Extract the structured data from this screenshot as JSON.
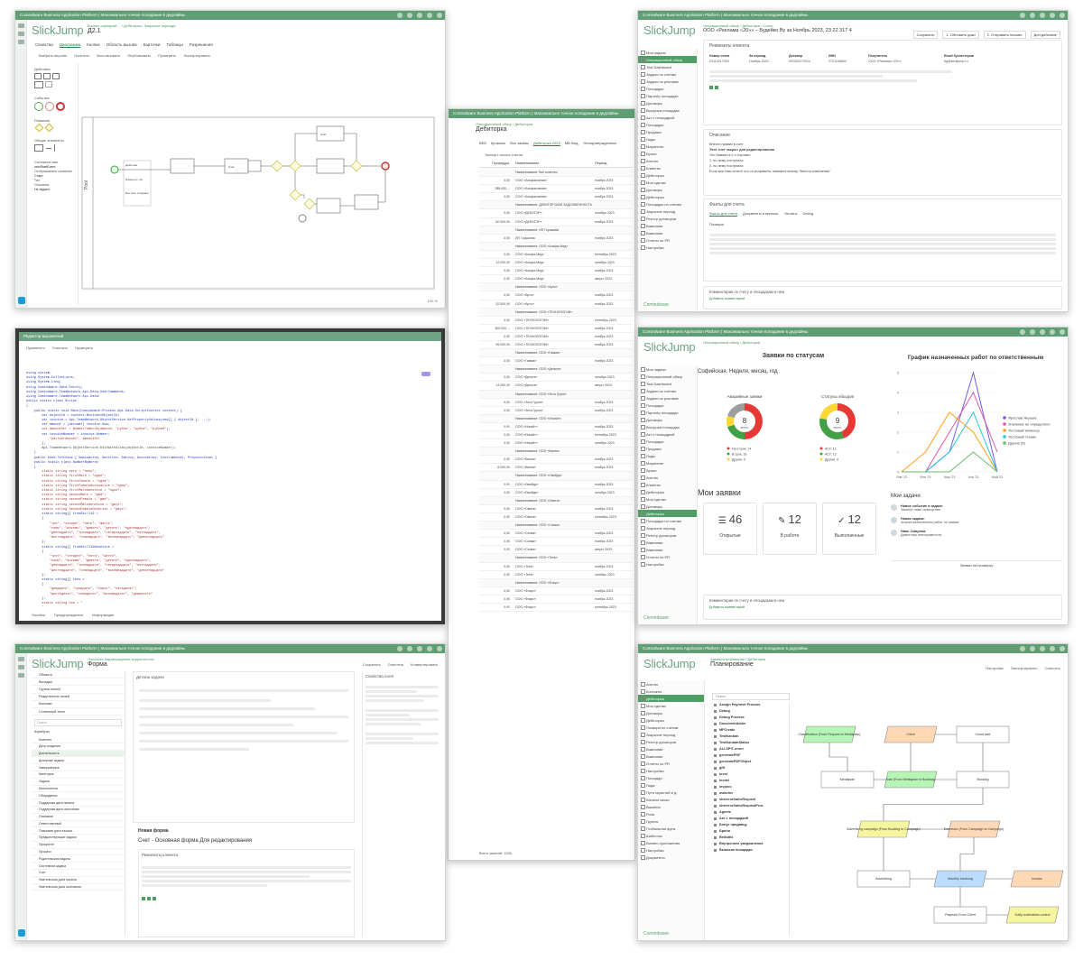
{
  "app_title": "Comindware Business Application Platform | Максимально точное попадание в дедлайны",
  "app_title_short": "Comindware Business Application Platform | Максимально точное попадание в дедлайны",
  "logo": "SlickJump",
  "footer_brand": "Comindware",
  "colors": {
    "accent": "#5e9e72",
    "nav_selected": "#4f9e66",
    "brand_blue": "#1a9bd7"
  },
  "win1": {
    "crumb": "Бизнес-сценарий ... / Дебиторка / Закрытие периода",
    "title": "Д2.1",
    "tabs": [
      "Свойства",
      "Диаграмма",
      "Кнопки",
      "Область вызова",
      "Карточки",
      "Таблицы",
      "Разрешения"
    ],
    "actions": [
      "Выбрать версию",
      "Очистить",
      "Восстановить",
      "Опубликовать",
      "Проверить",
      "Экспортировать"
    ],
    "palette_sections": [
      "Действия",
      "События",
      "Развилки",
      "Общие элементы"
    ],
    "palette_props": [
      "Системное имя",
      "Отображаемое название",
      "Тип",
      "Описание"
    ],
    "palette_prop_values": [
      "newStartEvent",
      "Старт",
      "Не задано"
    ],
    "pool_label": "Pool",
    "popup_title": "Изменить тип",
    "popup_sub": "Быстрое создание",
    "tasks": [
      "Действие",
      "Счет",
      "Счет"
    ],
    "footer_zoom": "100 %"
  },
  "win2": {
    "crumb": "Операционный обзор / Дебиторка",
    "title": "Дебиторка",
    "tabs": [
      "ВЕБ",
      "Кровные",
      "Все заказы",
      "Дебиторка 2023",
      "МВ бюд.",
      "Неподтвержденные"
    ],
    "toolbar": "Экспорт списка счетов",
    "columns": [
      "Процедура",
      "Наименование",
      "Период"
    ],
    "rows": [
      {
        "s": "",
        "n": "Наименование: Все клиенты",
        "p": ""
      },
      {
        "s": "0,00",
        "n": "ООО «Альфаклиник»",
        "p": "ноябрь 2023"
      },
      {
        "s": "288 000,...",
        "n": "ООО «Альфаклиник»",
        "p": "ноябрь 2023"
      },
      {
        "s": "0,00",
        "n": "ООО «Альфаклиник»",
        "p": "ноябрь 2023"
      },
      {
        "s": "",
        "n": "Наименование: ДЕБИТОРСКАЯ ЗАДОЛЖЕННОСТЬ",
        "p": ""
      },
      {
        "s": "0,00",
        "n": "ООО «ДЕБИТОР»",
        "p": "октябрь 2023"
      },
      {
        "s": "60 000,00",
        "n": "ООО «ДЕБИТОР»",
        "p": "ноябрь 2023"
      },
      {
        "s": "",
        "n": "Наименование: ИП Горшкова",
        "p": ""
      },
      {
        "s": "0,00",
        "n": "ИП Горшкова",
        "p": "ноябрь 2023"
      },
      {
        "s": "",
        "n": "Наименование: ООО «Альфа-Мед»",
        "p": ""
      },
      {
        "s": "0,00",
        "n": "ООО «Альфа-Мед»",
        "p": "сентябрь 2023"
      },
      {
        "s": "12 000,00",
        "n": "ООО «Альфа-Мед»",
        "p": "октябрь 2023"
      },
      {
        "s": "0,00",
        "n": "ООО «Альфа-Мед»",
        "p": "ноябрь 2023"
      },
      {
        "s": "0,00",
        "n": "ООО «Альфа-Мед»",
        "p": "август 2023"
      },
      {
        "s": "",
        "n": "Наименование: ООО «Арто»",
        "p": ""
      },
      {
        "s": "0,00",
        "n": "ООО «Арто»",
        "p": "ноябрь 2023"
      },
      {
        "s": "32 000,00",
        "n": "ООО «Арто»",
        "p": "ноябрь 2023"
      },
      {
        "s": "",
        "n": "Наименование: ООО «ТЕХНОЛОГИИ»",
        "p": ""
      },
      {
        "s": "0,00",
        "n": "ООО «ТЕХНОЛОГИИ»",
        "p": "сентябрь 2023"
      },
      {
        "s": "500 000,...",
        "n": "ООО «ТЕХНОЛОГИИ»",
        "p": "ноябрь 2023"
      },
      {
        "s": "0,00",
        "n": "ООО «ТЕХНОЛОГИИ»",
        "p": "ноябрь 2023"
      },
      {
        "s": "96 000,00",
        "n": "ООО «ТЕХНОЛОГИИ»",
        "p": "ноябрь 2023"
      },
      {
        "s": "",
        "n": "Наименование: ООО «Гамма»",
        "p": ""
      },
      {
        "s": "0,00",
        "n": "ООО «Гамма»",
        "p": "ноябрь 2023"
      },
      {
        "s": "",
        "n": "Наименование: ООО «Дельта»",
        "p": ""
      },
      {
        "s": "0,00",
        "n": "ООО «Дельта»",
        "p": "октябрь 2023"
      },
      {
        "s": "14 000,00",
        "n": "ООО «Дельта»",
        "p": "август 2023"
      },
      {
        "s": "",
        "n": "Наименование: ООО «Зета Групп»",
        "p": ""
      },
      {
        "s": "0,00",
        "n": "ООО «Зета Групп»",
        "p": "ноябрь 2023"
      },
      {
        "s": "0,00",
        "n": "ООО «Зета Групп»",
        "p": "ноябрь 2023"
      },
      {
        "s": "",
        "n": "Наименование: ООО «Инсайт»",
        "p": ""
      },
      {
        "s": "0,00",
        "n": "ООО «Инсайт»",
        "p": "ноябрь 2023"
      },
      {
        "s": "0,00",
        "n": "ООО «Инсайт»",
        "p": "сентябрь 2023"
      },
      {
        "s": "0,00",
        "n": "ООО «Инсайт»",
        "p": "октябрь 2023"
      },
      {
        "s": "",
        "n": "Наименование: ООО «Каппа»",
        "p": ""
      },
      {
        "s": "0,00",
        "n": "ООО «Каппа»",
        "p": "ноябрь 2023"
      },
      {
        "s": "8 000,00",
        "n": "ООО «Каппа»",
        "p": "ноябрь 2023"
      },
      {
        "s": "",
        "n": "Наименование: ООО «Лямбда»",
        "p": ""
      },
      {
        "s": "0,00",
        "n": "ООО «Лямбда»",
        "p": "ноябрь 2023"
      },
      {
        "s": "0,00",
        "n": "ООО «Лямбда»",
        "p": "октябрь 2023"
      },
      {
        "s": "",
        "n": "Наименование: ООО «Омега»",
        "p": ""
      },
      {
        "s": "0,00",
        "n": "ООО «Омега»",
        "p": "ноябрь 2023"
      },
      {
        "s": "0,00",
        "n": "ООО «Омега»",
        "p": "сентябрь 2023"
      },
      {
        "s": "",
        "n": "Наименование: ООО «Сигма»",
        "p": ""
      },
      {
        "s": "0,00",
        "n": "ООО «Сигма»",
        "p": "ноябрь 2023"
      },
      {
        "s": "0,00",
        "n": "ООО «Сигма»",
        "p": "ноябрь 2023"
      },
      {
        "s": "0,00",
        "n": "ООО «Сигма»",
        "p": "август 2023"
      },
      {
        "s": "",
        "n": "Наименование: ООО «Тета»",
        "p": ""
      },
      {
        "s": "0,00",
        "n": "ООО «Тета»",
        "p": "ноябрь 2023"
      },
      {
        "s": "0,00",
        "n": "ООО «Тета»",
        "p": "октябрь 2023"
      },
      {
        "s": "",
        "n": "Наименование: ООО «Фокус»",
        "p": ""
      },
      {
        "s": "0,00",
        "n": "ООО «Фокус»",
        "p": "ноябрь 2023"
      },
      {
        "s": "0,00",
        "n": "ООО «Фокус»",
        "p": "ноябрь 2023"
      },
      {
        "s": "0,00",
        "n": "ООО «Фокус»",
        "p": "сентябрь 2023"
      }
    ],
    "footer": "Всего записей: 1928"
  },
  "win3": {
    "crumb": "Операционный обзор / Дебиторка / Счета",
    "title": "ООО «Реклама «20»» – Будейко Ву за Ноябрь 2023, 23 22 317 4",
    "top_actions": [
      "Сохранить",
      "1. Обновить доки",
      "2. Отправить письмо",
      "Доп.действие"
    ],
    "nav_items": [
      "Мои задачи",
      "Операционный обзор",
      "Test Dashboard",
      "Задачи по счетам",
      "Задачи по рекламе",
      "Площадки",
      "Партнёр площадки",
      "Договоры",
      "Выгрузка площадок",
      "Акт с площадкой",
      "Площадки",
      "Продажи",
      "Лиды",
      "Маркетинг",
      "Брони",
      "Агенты",
      "Клиенты",
      "Дебиторка",
      "Мои сделки",
      "Договоры",
      "Дебиторка",
      "Площадки по счетам",
      "Закрытие период",
      "Реестр договоров",
      "Кампании",
      "Кампании",
      "Отчеты по PR",
      "Настройки"
    ],
    "section_client": "Реквизиты клиента",
    "client_labels": [
      "Номер счета",
      "За период",
      "Договор",
      "ИНН",
      "Получатель",
      "Email бухгалтерии"
    ],
    "client_values": [
      "23112017904",
      "Ноябрь 2023",
      "202303172914",
      "2721108604",
      "ООО «Реклама «20»»",
      "bg@slickjump.ru"
    ],
    "section_notes": "Описание",
    "notes": [
      "Внести правки в счет",
      "Этот счет закрыт для редактирования",
      "Это бывает в 2-х случаях:",
      "1. по нему поступила",
      "2. по нему поступила",
      "Если вся таки хотите что-то исправить, нажмите кнопку \"Внести изменения\""
    ],
    "section_invoice": "Факты для счета",
    "invoice_tabs": [
      "Факты для счета",
      "Документы и прилож.",
      "Оплаты",
      "Debug"
    ],
    "invoice_table": "Позиции",
    "comments_title": "Комментарии по счету и площадкам в нем",
    "comment_add": "Добавить комментарий"
  },
  "win4": {
    "crumb": "Нельзя подтвердить в редакторе",
    "title": "Редактор выражений",
    "actions": [
      "Применить",
      "Очистить",
      "Проверить"
    ],
    "status_tabs": [
      "Ошибки",
      "Предупреждения",
      "Информация"
    ],
    "code": [
      "using System;",
      "using System.Collections;",
      "using System.Linq;",
      "using Comindware.Data.Entity;",
      "using Comindware.TeamNetwork.Api.Data.UserCommands;",
      "using Comindware.TeamNetwork.Api.Data;",
      "public static class Script",
      "{",
      "    public static void Main(Comindware.Process.Api.Data.ScriptContext context) {",
      "",
      "        var objectId = context.BusinessObjectId;",
      "        var invoice = Api.TeamNetwork.ObjectService.GetPropertyValues(new[] { objectId }, ...);",
      "",
      "        var amount = (decimal) invoice.Sum;",
      "        var amountStr = NumberToWords(amount, \"рубль\", \"рубля\", \"рублей\");",
      "        var invoiceNumber = invoice.Number;",
      "            \"partnerAmount\", amountStr",
      "        };",
      "        Api.TeamNetwork.ObjectService.EditWithAlias(objectId, invoiceNumber);",
      "    }",
      "",
      "    public enum TextCase { Nominative, Genitive, Dative, Accusative, Instrumental, Prepositional }",
      "",
      "    public static class NumberByWords",
      "    {",
      "        static string zero = \"ноль\";",
      "        static string firstMale = \"один\";",
      "        static string firstFemale = \"одна\";",
      "        static string firstFemaleAccusative = \"одну\";",
      "        static string firstMaleGenetive = \"одно\";",
      "        static string secondMale = \"два\";",
      "        static string secondFemale = \"две\";",
      "        static string secondMaleGenetive = \"двух\";",
      "        static string secondFemaleGenetive = \"двух\";",
      "",
      "        static string[] from3till19 =",
      "        {",
      "            \"три\", \"четыре\", \"пять\", \"шесть\",",
      "            \"семь\", \"восемь\", \"девять\", \"десять\", \"одиннадцать\",",
      "            \"двенадцать\", \"тринадцать\", \"четырнадцать\", \"пятнадцать\",",
      "            \"шестнадцать\", \"семнадцать\", \"восемнадцать\", \"девятнадцать\"",
      "        };",
      "        static string[] from3till19Genetive =",
      "        {",
      "            \"трех\", \"четырех\", \"пяти\", \"шести\",",
      "            \"семи\", \"восеми\", \"девяти\", \"десяти\", \"одиннадцати\",",
      "            \"двенадцати\", \"тринадцати\", \"четырнадцати\", \"пятнадцати\",",
      "            \"шестнадцати\", \"семнадцати\", \"восемнадцати\", \"девятнадцати\"",
      "        };",
      "        static string[] tens =",
      "        {",
      "            \"двадцать\", \"тридцать\", \"сорок\", \"пятьдесят\",",
      "            \"шестьдесят\", \"семьдесят\", \"восемьдесят\", \"девяносто\"",
      "        };",
      "        static string hnd = \"",
      "        {",
      "            \"сто\", \"двести\", \"триста\", \"четыреста\",",
      "            \"пятьсот\", \"шестьсот\", \"семьсот\", \"восемьсот\", \"девятьсот\"",
      "        };"
    ]
  },
  "win5": {
    "crumb": "Операционный обзор / Дебиторка",
    "title": "Заявки по статусам",
    "chart_title": "График назначенных работ по ответственным",
    "donut_card": "Софийская. Неделя, месяц, год",
    "donut1_label": "Аварийные заявки",
    "donut1_value": "8",
    "donut1_caption": "всего",
    "donut2_label": "Статусы обходов",
    "donut2_value": "9",
    "donut2_caption": "всего",
    "donut1_legend": [
      "На в срок: 14",
      "В срок: 18",
      "Другие: 0"
    ],
    "donut2_legend": [
      "АСУ: 11",
      "АСУ: 12",
      "Другие: 6"
    ],
    "my_requests": "Мои заявки",
    "tiles": [
      {
        "n": "46",
        "l": "Открытые",
        "icon": "list-icon"
      },
      {
        "n": "12",
        "l": "В работе",
        "icon": "wrench-icon"
      },
      {
        "n": "12",
        "l": "Выполненные",
        "icon": "check-icon"
      }
    ],
    "my_tasks": "Мои задачи",
    "tasks": [
      {
        "t": "Новое событие в задаче:",
        "d": "Замена ламп освещения"
      },
      {
        "t": "Новая задача:",
        "d": "Анализ выполнения работ по заявке"
      },
      {
        "t": "Иван Смирнов",
        "d": "Демонтаж неисправности"
      }
    ],
    "task_button": "Заявки на проверку",
    "legend": [
      "Ярослав Якушев",
      "Значение не определено",
      "Тестовый инженер",
      "Тестовый техник",
      "Другие (5)"
    ],
    "legend_colors": [
      "#6c5ce7",
      "#e056a0",
      "#ff9f1a",
      "#26c6da",
      "#66bb6a"
    ],
    "x_labels": [
      "Янв '23",
      "Фев '23",
      "Мар '23",
      "Апр '23",
      "Май '23"
    ],
    "y_labels": [
      "0",
      "1",
      "2",
      "3",
      "4",
      "5"
    ],
    "comments_title": "Комментарии по счету и площадкам в нем",
    "comment_add": "Добавить комментарий"
  },
  "win6": {
    "crumb": "Получить подтверждение корректности",
    "title": "Форма",
    "top_actions": [
      "Сохранить",
      "Очистить",
      "Конвертировать"
    ],
    "left_items": [
      "Область",
      "Вкладка",
      "Группа полей",
      "Разделитель полей",
      "Колонки",
      "Статичный текст"
    ],
    "search": "Поиск",
    "attrs_title": "Атрибуты",
    "attrs": [
      "Клиенты",
      "Дата создания",
      "Длительность",
      "Дочерние задачи",
      "Завершенные",
      "Категория",
      "Задача",
      "Исполнитель",
      "Обсуждения",
      "Поддержка дата начала",
      "Поддержка дата окончания",
      "Описание",
      "Ответственный",
      "Плановая дата начала",
      "Предшествующие задачи",
      "Приоритет",
      "Процесс",
      "Родительская задача",
      "Системная задача",
      "Счет",
      "Фактическая дата начала",
      "Фактическая дата окончания"
    ],
    "form_title": "Детали задачи",
    "props_title": "Свойства поля",
    "form2_title": "Счет - Основная форма Для редактирования",
    "new_form": "Новая форма",
    "client_section": "Реквизиты клиента"
  },
  "win7": {
    "crumb": "Администрирование / Дебиторка",
    "title": "Планирование",
    "top_actions": [
      "Настройки",
      "Экспортировать",
      "Очистить"
    ],
    "search": "Поиск",
    "nav_items": [
      "Агенты",
      "Контакты",
      "Дебиторка",
      "Мои сделки",
      "Договоры",
      "Дебиторка",
      "Позиции по счетам",
      "Закрытие период",
      "Реестр договоров",
      "Кампании",
      "Кампании",
      "Отчеты по PR",
      "Настройки",
      "Площади",
      "Лида",
      "Пути гарантий в д.",
      "Каналы связи",
      "Вакансы",
      "Роли",
      "Группы",
      "Глобальная функ.",
      "Шаблоны",
      "Бизнес-приложения",
      "Настройки",
      "Документы"
    ],
    "list_items": [
      "Assign Payment Process",
      "Debug",
      "Debug Process",
      "DocumentAdder",
      "MFCreate",
      "TestKanban",
      "TestKanbanStatus",
      "ALLSPIT-отчет",
      "generatePDF",
      "generatePDFObject",
      "gift",
      "invst",
      "invdel",
      "invproc",
      "makeInv",
      "shserrorSalesRequest",
      "shserrorSalesRequestProc",
      "Agents",
      "Акт с площадкой",
      "Бонус продавцу",
      "Брони",
      "Bellcalls",
      "Внутреннее уведомление",
      "Выписка площадки"
    ],
    "nodes": [
      {
        "id": "n1",
        "t": "Classification (From Request to Mediaplan)",
        "c": "#b6f5b6"
      },
      {
        "id": "n2",
        "t": "Client",
        "c": "#ffd8b6"
      },
      {
        "id": "n3",
        "t": "Cross sale",
        "c": "#ffffff"
      },
      {
        "id": "n4",
        "t": "Mediaplan",
        "c": "#ffffff"
      },
      {
        "id": "n5",
        "t": "Sale (From Mediaplan to Booking)",
        "c": "#b6f5b6"
      },
      {
        "id": "n6",
        "t": "Booking",
        "c": "#ffffff"
      },
      {
        "id": "n7",
        "t": "Advertising campaign (From Booking to Campaign)",
        "c": "#f5f5a0"
      },
      {
        "id": "n8",
        "t": "Extension (From Campaign to Campaign)",
        "c": "#ffd8b6"
      },
      {
        "id": "n9",
        "t": "Advertising",
        "c": "#ffffff"
      },
      {
        "id": "n10",
        "t": "Monthly invoicing",
        "c": "#bcdcff"
      },
      {
        "id": "n11",
        "t": "Invoice",
        "c": "#ffd8b6"
      },
      {
        "id": "n12",
        "t": "Payment From Client",
        "c": "#ffffff"
      },
      {
        "id": "n13",
        "t": "Daily receivables control",
        "c": "#f5f5a0"
      }
    ]
  }
}
